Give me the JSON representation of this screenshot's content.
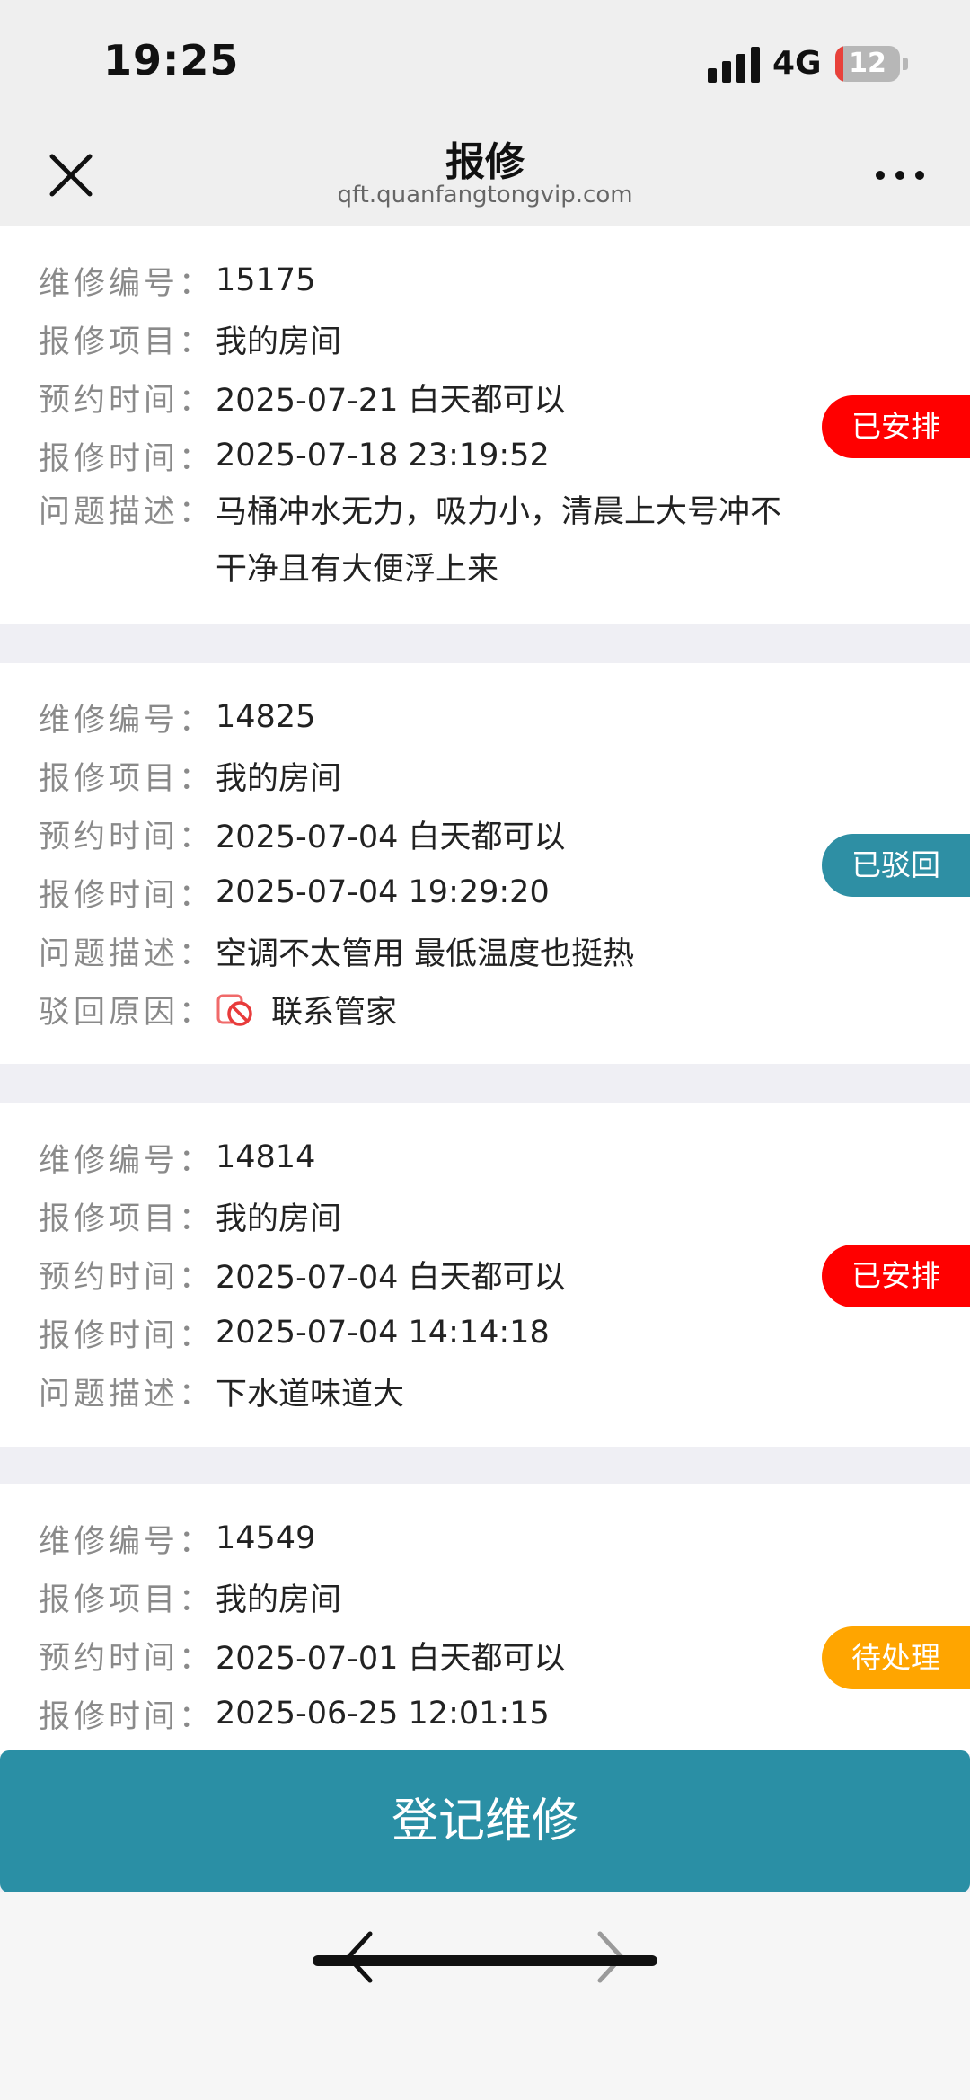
{
  "status_bar": {
    "time": "19:25",
    "network": "4G",
    "battery": "12",
    "battery_level": 0.12
  },
  "header": {
    "title": "报修",
    "url": "qft.quanfangtongvip.com"
  },
  "field_labels": {
    "repair_no": "维修编号",
    "item": "报修项目",
    "appointment": "预约时间",
    "report_time": "报修时间",
    "description": "问题描述",
    "reject_reason": "驳回原因",
    "colon": "："
  },
  "repairs": [
    {
      "repair_no": "15175",
      "item": "我的房间",
      "appointment": "2025-07-21 白天都可以",
      "report_time": "2025-07-18 23:19:52",
      "description": "马桶冲水无力，吸力小，清晨上大号冲不干净且有大便浮上来",
      "status": "已安排",
      "status_color": "#ff0000"
    },
    {
      "repair_no": "14825",
      "item": "我的房间",
      "appointment": "2025-07-04 白天都可以",
      "report_time": "2025-07-04 19:29:20",
      "description": "空调不太管用 最低温度也挺热",
      "reject_reason": "联系管家",
      "status": "已驳回",
      "status_color": "#2e8fa4"
    },
    {
      "repair_no": "14814",
      "item": "我的房间",
      "appointment": "2025-07-04 白天都可以",
      "report_time": "2025-07-04 14:14:18",
      "description": "下水道味道大",
      "status": "已安排",
      "status_color": "#ff0000"
    },
    {
      "repair_no": "14549",
      "item": "我的房间",
      "appointment": "2025-07-01 白天都可以",
      "report_time": "2025-06-25 12:01:15",
      "status": "待处理",
      "status_color": "#ffa500"
    }
  ],
  "register_button": {
    "label": "登记维修",
    "color": "#2a8fa5"
  },
  "icons": {
    "close": "close-icon",
    "more": "more-icon",
    "reject": "prohibited-icon",
    "back": "chevron-left-icon",
    "forward": "chevron-right-icon"
  }
}
